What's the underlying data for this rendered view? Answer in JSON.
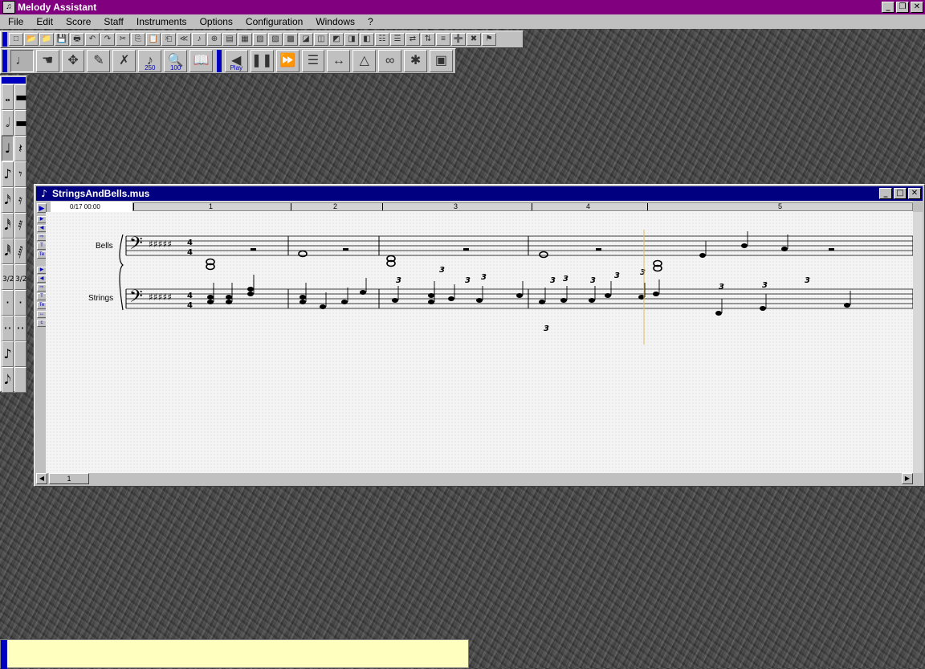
{
  "app": {
    "title": "Melody Assistant"
  },
  "window_buttons": {
    "minimize": "_",
    "restore": "❐",
    "close": "✕"
  },
  "menu": [
    {
      "label": "File"
    },
    {
      "label": "Edit"
    },
    {
      "label": "Score"
    },
    {
      "label": "Staff"
    },
    {
      "label": "Instruments"
    },
    {
      "label": "Options"
    },
    {
      "label": "Configuration"
    },
    {
      "label": "Windows"
    },
    {
      "label": "?"
    }
  ],
  "toolbar_main": {
    "icons": [
      "new-icon",
      "open-icon",
      "open-folder-icon",
      "save-icon",
      "print-icon",
      "undo-icon",
      "redo-icon",
      "cut-icon",
      "copy-icon",
      "paste-icon",
      "paste-special-icon",
      "shift-left-icon",
      "note-icon",
      "zoom-icon",
      "tool-a-icon",
      "tool-b-icon",
      "tool-c-icon",
      "tool-d-icon",
      "tool-e-icon",
      "tool-f-icon",
      "tool-g-icon",
      "tool-h-icon",
      "tool-i-icon",
      "tool-j-icon",
      "tool-k-icon",
      "tool-l-icon",
      "tool-m-icon",
      "tool-n-icon",
      "list-icon",
      "insert-icon",
      "delete-icon",
      "green-flag-icon"
    ]
  },
  "toolbar_big": {
    "buttons": [
      {
        "name": "edit-tool-button",
        "glyph": "♩",
        "sub": ""
      },
      {
        "name": "hand-tool-button",
        "glyph": "☚",
        "sub": ""
      },
      {
        "name": "move-tool-button",
        "glyph": "✥",
        "sub": ""
      },
      {
        "name": "pencil-tool-button",
        "glyph": "✎",
        "sub": ""
      },
      {
        "name": "eraser-tool-button",
        "glyph": "✗",
        "sub": ""
      },
      {
        "name": "tempo-tool-button",
        "glyph": "♪",
        "sub": "250"
      },
      {
        "name": "zoom-tool-button",
        "glyph": "🔍",
        "sub": "100"
      },
      {
        "name": "book-button",
        "glyph": "📖",
        "sub": ""
      },
      {
        "name": "play-button",
        "glyph": "◀",
        "sub": "Play"
      },
      {
        "name": "pause-button",
        "glyph": "❚❚",
        "sub": ""
      },
      {
        "name": "forward-rewind-button",
        "glyph": "⏩",
        "sub": ""
      },
      {
        "name": "loop-button",
        "glyph": "☰",
        "sub": ""
      },
      {
        "name": "transpose-button",
        "glyph": "↔",
        "sub": ""
      },
      {
        "name": "metronome-button",
        "glyph": "△",
        "sub": ""
      },
      {
        "name": "link-button",
        "glyph": "∞",
        "sub": ""
      },
      {
        "name": "conductor-button",
        "glyph": "✱",
        "sub": ""
      },
      {
        "name": "jukebox-button",
        "glyph": "▣",
        "sub": ""
      }
    ]
  },
  "palette": {
    "left": [
      "𝅝",
      "𝅗𝅥",
      "♩",
      "♪",
      "𝅘𝅥𝅯",
      "𝅘𝅥𝅰",
      "𝅘𝅥𝅱",
      "3/2",
      "·",
      "··",
      "♪",
      "𝅘𝅥𝅮"
    ],
    "right": [
      "▬",
      "▬",
      "𝄽",
      "𝄾",
      "𝄿",
      "𝅀",
      "𝅁",
      "3/2",
      "·",
      "··",
      "",
      ""
    ]
  },
  "document": {
    "title": "StringsAndBells.mus",
    "time": "0/17 00:00",
    "measure_numbers": [
      "1",
      "2",
      "3",
      "4",
      "5"
    ],
    "page_number": "1",
    "staves": [
      {
        "label": "Bells"
      },
      {
        "label": "Strings"
      }
    ]
  }
}
